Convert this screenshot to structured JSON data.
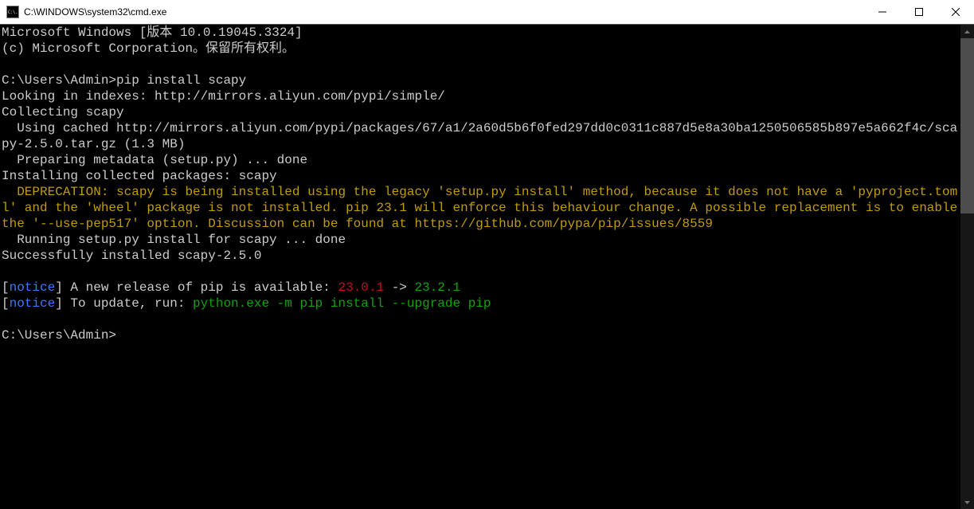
{
  "window": {
    "icon_text": "C:\\.",
    "title": "C:\\WINDOWS\\system32\\cmd.exe"
  },
  "lines": [
    {
      "segments": [
        {
          "cls": "c-white",
          "text": "Microsoft Windows [版本 10.0.19045.3324]"
        }
      ]
    },
    {
      "segments": [
        {
          "cls": "c-white",
          "text": "(c) Microsoft Corporation。保留所有权利。"
        }
      ]
    },
    {
      "segments": [
        {
          "cls": "c-white",
          "text": ""
        }
      ]
    },
    {
      "segments": [
        {
          "cls": "c-white",
          "text": "C:\\Users\\Admin>pip install scapy"
        }
      ]
    },
    {
      "segments": [
        {
          "cls": "c-white",
          "text": "Looking in indexes: http://mirrors.aliyun.com/pypi/simple/"
        }
      ]
    },
    {
      "segments": [
        {
          "cls": "c-white",
          "text": "Collecting scapy"
        }
      ]
    },
    {
      "segments": [
        {
          "cls": "c-white",
          "text": "  Using cached http://mirrors.aliyun.com/pypi/packages/67/a1/2a60d5b6f0fed297dd0c0311c887d5e8a30ba1250506585b897e5a662f4c/scapy-2.5.0.tar.gz (1.3 MB)"
        }
      ]
    },
    {
      "segments": [
        {
          "cls": "c-white",
          "text": "  Preparing metadata (setup.py) ... done"
        }
      ]
    },
    {
      "segments": [
        {
          "cls": "c-white",
          "text": "Installing collected packages: scapy"
        }
      ]
    },
    {
      "segments": [
        {
          "cls": "c-yellow",
          "text": "  DEPRECATION: scapy is being installed using the legacy 'setup.py install' method, because it does not have a 'pyproject.toml' and the 'wheel' package is not installed. pip 23.1 will enforce this behaviour change. A possible replacement is to enable the '--use-pep517' option. Discussion can be found at https://github.com/pypa/pip/issues/8559"
        }
      ]
    },
    {
      "segments": [
        {
          "cls": "c-white",
          "text": "  Running setup.py install for scapy ... done"
        }
      ]
    },
    {
      "segments": [
        {
          "cls": "c-white",
          "text": "Successfully installed scapy-2.5.0"
        }
      ]
    },
    {
      "segments": [
        {
          "cls": "c-white",
          "text": ""
        }
      ]
    },
    {
      "segments": [
        {
          "cls": "c-white",
          "text": "["
        },
        {
          "cls": "c-blue",
          "text": "notice"
        },
        {
          "cls": "c-white",
          "text": "] A new release of pip is available: "
        },
        {
          "cls": "c-red",
          "text": "23.0.1"
        },
        {
          "cls": "c-white",
          "text": " -> "
        },
        {
          "cls": "c-green",
          "text": "23.2.1"
        }
      ]
    },
    {
      "segments": [
        {
          "cls": "c-white",
          "text": "["
        },
        {
          "cls": "c-blue",
          "text": "notice"
        },
        {
          "cls": "c-white",
          "text": "] To update, run: "
        },
        {
          "cls": "c-green",
          "text": "python.exe -m pip install --upgrade pip"
        }
      ]
    },
    {
      "segments": [
        {
          "cls": "c-white",
          "text": ""
        }
      ]
    },
    {
      "segments": [
        {
          "cls": "c-white",
          "text": "C:\\Users\\Admin>"
        }
      ]
    }
  ]
}
